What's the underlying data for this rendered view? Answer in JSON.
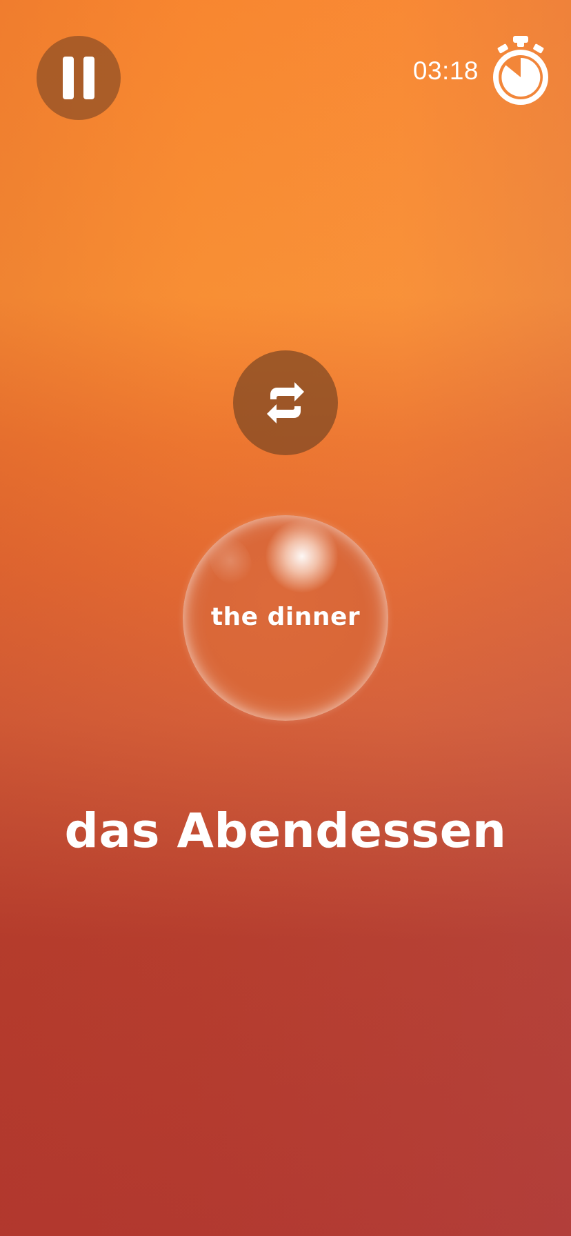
{
  "timer": {
    "value": "03:18",
    "icon": "stopwatch-icon"
  },
  "controls": {
    "pause_icon": "pause-icon",
    "repeat_icon": "repeat-icon"
  },
  "flashcard": {
    "translation": "the dinner",
    "word": "das Abendessen"
  },
  "colors": {
    "background_top": "#ff8e31",
    "background_bottom": "#b33a31",
    "button_fill": "#7d4623",
    "text": "#ffffff"
  }
}
